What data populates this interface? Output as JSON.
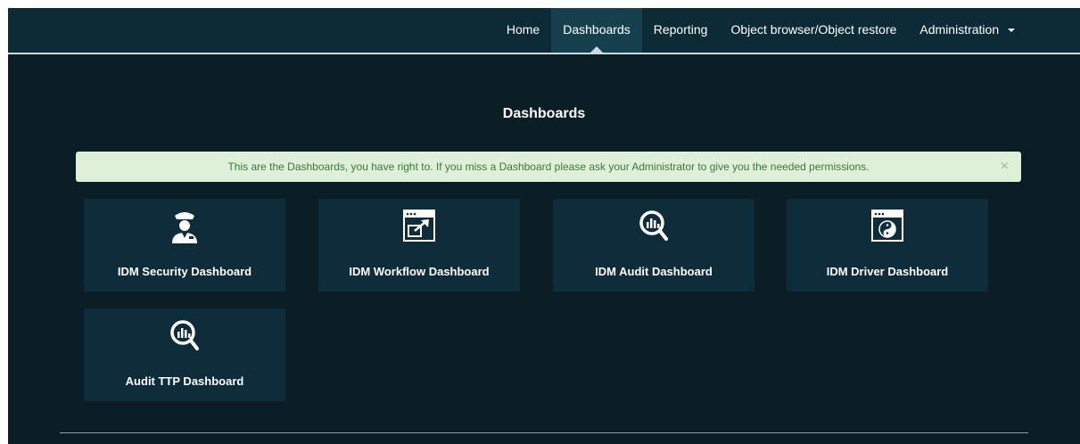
{
  "nav": {
    "items": [
      {
        "label": "Home"
      },
      {
        "label": "Dashboards",
        "active": true
      },
      {
        "label": "Reporting"
      },
      {
        "label": "Object browser/Object restore"
      },
      {
        "label": "Administration",
        "dropdown": true
      }
    ]
  },
  "page": {
    "title": "Dashboards"
  },
  "alert": {
    "text": "This are the Dashboards, you have right to. If you miss a Dashboard please ask your Administrator to give you the needed permissions.",
    "close": "×"
  },
  "tiles": [
    {
      "label": "IDM Security Dashboard",
      "icon": "security-guard-icon"
    },
    {
      "label": "IDM Workflow Dashboard",
      "icon": "workflow-window-icon"
    },
    {
      "label": "IDM Audit Dashboard",
      "icon": "audit-magnifier-icon"
    },
    {
      "label": "IDM Driver Dashboard",
      "icon": "driver-yin-yang-icon"
    },
    {
      "label": "Audit TTP Dashboard",
      "icon": "audit-magnifier-icon"
    }
  ],
  "colors": {
    "background": "#0b1e26",
    "navbar": "#0d2a37",
    "tile": "#0f2c3a",
    "alert_bg": "#dff0d8",
    "alert_text": "#3c763d"
  }
}
